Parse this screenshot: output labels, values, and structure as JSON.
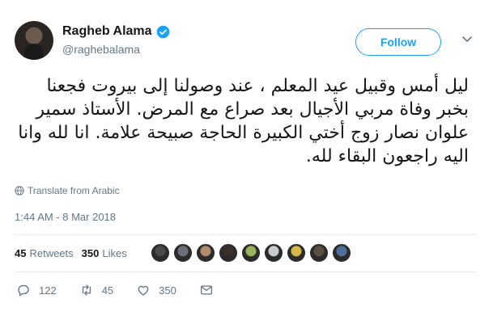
{
  "user": {
    "name": "Ragheb Alama",
    "handle": "@raghebalama",
    "verified": true
  },
  "follow_label": "Follow",
  "tweet": {
    "text": "ليل أمس وقبيل عيد المعلم ، عند وصولنا إلى بيروت فجعنا بخبر وفاة مربي الأجيال بعد صراع مع المرض. الأستاذ سمير علوان نصار زوج أختي الكبيرة الحاجة صبيحة علامة.  انا لله وانا اليه راجعون البقاء لله."
  },
  "translate_label": "Translate from Arabic",
  "timestamp": "1:44 AM - 8 Mar 2018",
  "stats": {
    "retweets_count": "45",
    "retweets_label": "Retweets",
    "likes_count": "350",
    "likes_label": "Likes"
  },
  "liker_avatar_colors": [
    "#4a4a4a",
    "#6d6f7c",
    "#b58a6a",
    "#3a2f2b",
    "#9bb35a",
    "#c8ccd0",
    "#d9b64a",
    "#5b5040",
    "#4d6f9a"
  ],
  "actions": {
    "reply_count": "122",
    "retweet_count": "45",
    "like_count": "350"
  },
  "colors": {
    "accent": "#1da1f2",
    "text": "#14171a",
    "muted": "#657786"
  }
}
